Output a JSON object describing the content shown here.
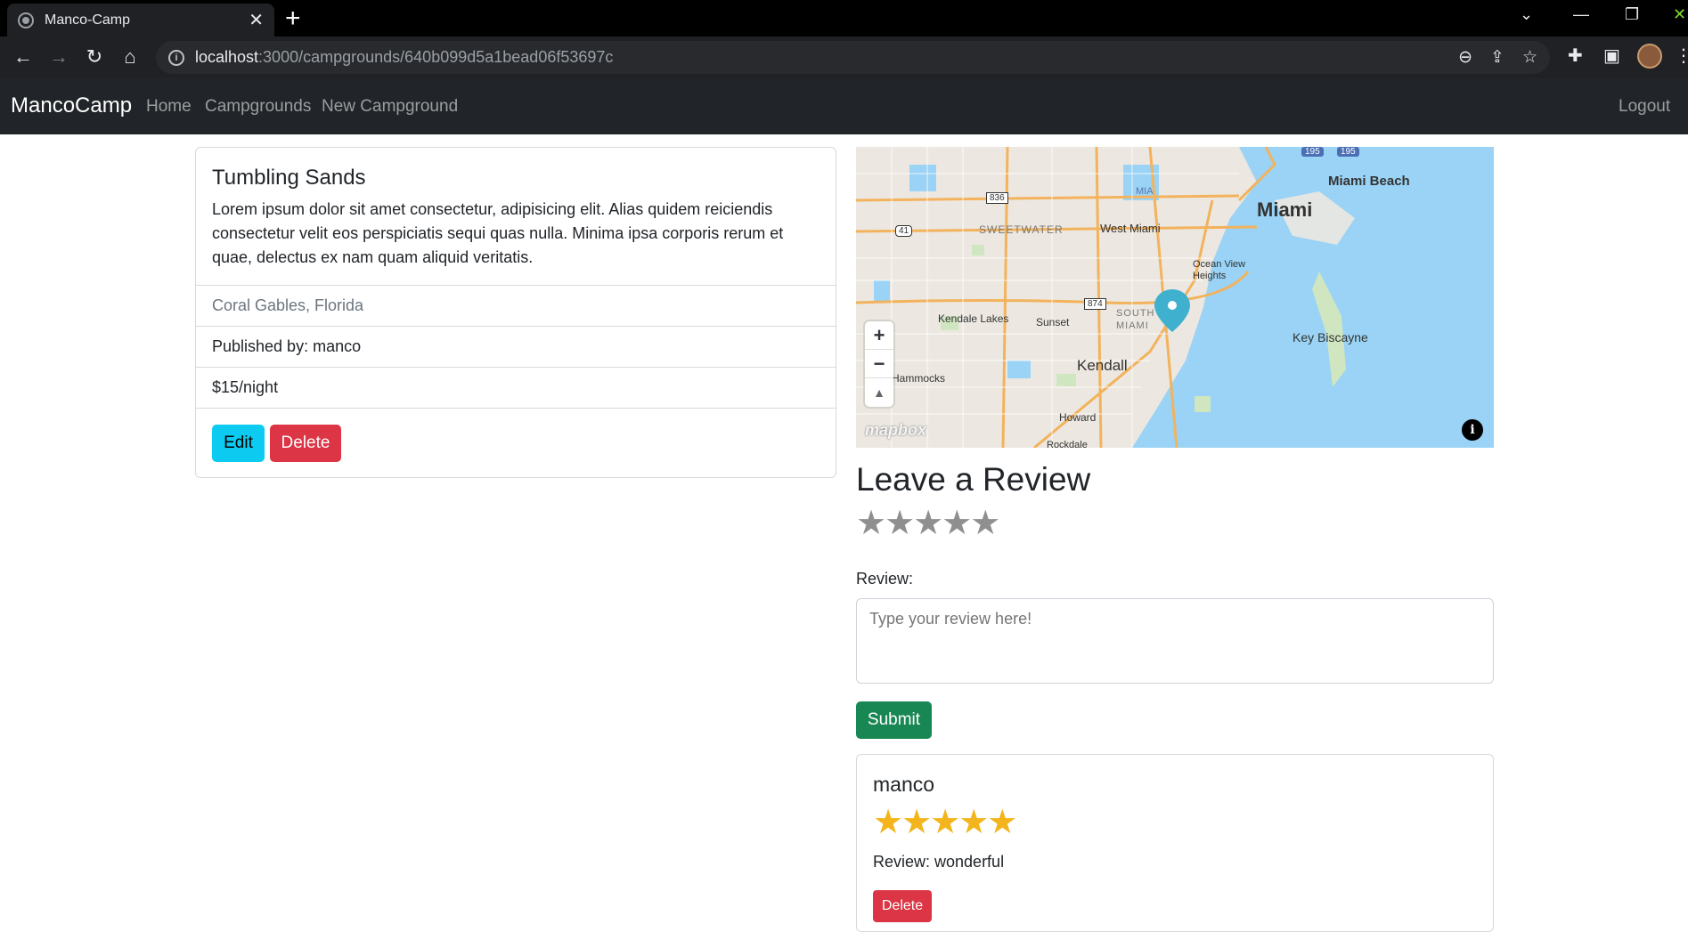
{
  "browser": {
    "tab_title": "Manco-Camp",
    "tab_close": "✕",
    "new_tab": "+",
    "url_host": "localhost",
    "url_path": ":3000/campgrounds/640b099d5a1bead06f53697c",
    "window_controls": [
      "⌄",
      "—",
      "❐",
      "✕"
    ],
    "nav_icons": [
      "←",
      "→",
      "↻",
      "⌂"
    ],
    "omnibox_icons": [
      "zoom-icon",
      "share-icon",
      "bookmark-star-icon"
    ],
    "omnibox_glyphs": [
      "⊖",
      "⇪",
      "☆"
    ],
    "extension_icons": [
      "puzzle-icon",
      "sidepanel-icon",
      "menu-icon"
    ],
    "extension_glyphs": [
      "✚",
      "▣",
      "⋮"
    ]
  },
  "navbar": {
    "brand": "MancoCamp",
    "links": [
      "Home",
      "Campgrounds",
      "New Campground"
    ],
    "logout": "Logout"
  },
  "campground": {
    "title": "Tumbling Sands",
    "description": "Lorem ipsum dolor sit amet consectetur, adipisicing elit. Alias quidem reiciendis consectetur velit eos perspiciatis sequi quas nulla. Minima ipsa corporis rerum et quae, delectus ex nam quam aliquid veritatis.",
    "location": "Coral Gables, Florida",
    "published_by": "Published by: manco",
    "price": "$15/night",
    "edit_label": "Edit",
    "delete_label": "Delete"
  },
  "map": {
    "labels": [
      "Miami Beach",
      "Miami",
      "MIA",
      "West Miami",
      "SWEETWATER",
      "Ocean View Heights",
      "Kendale Lakes",
      "Sunset",
      "SOUTH MIAMI",
      "Key Biscayne",
      "Kendall",
      "Hammocks",
      "Howard",
      "Rockdale"
    ],
    "route_shields": [
      "195",
      "195",
      "836",
      "41",
      "874"
    ],
    "zoom_in": "+",
    "zoom_out": "−",
    "compass": "▲",
    "attribution_logo": "mapbox",
    "info_button": "i",
    "colors": {
      "water": "#9ad3f5",
      "land": "#ece8e1",
      "road": "#f3b25c"
    }
  },
  "review_form": {
    "heading": "Leave a Review",
    "rating_stars": "★★★★★",
    "rating_value": 0,
    "review_label": "Review:",
    "review_placeholder": "Type your review here!",
    "submit_label": "Submit"
  },
  "reviews": [
    {
      "author": "manco",
      "stars": "★★★★★",
      "rating": 5,
      "text": "Review: wonderful",
      "delete_label": "Delete"
    }
  ],
  "colors": {
    "navbar_bg": "#212529",
    "edit": "#0dcaf0",
    "danger": "#dc3545",
    "success": "#198754",
    "star_filled": "#f3b51b",
    "star_empty": "#8f8f8f"
  }
}
